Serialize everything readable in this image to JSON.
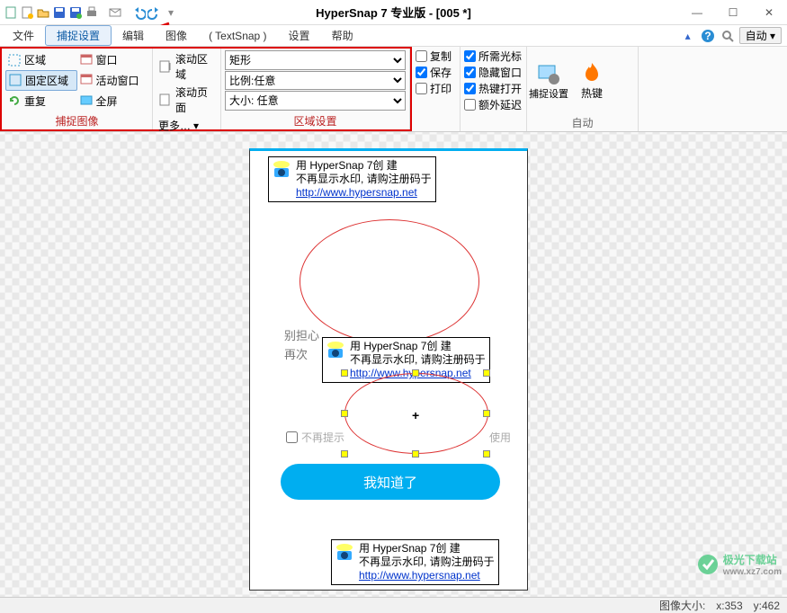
{
  "title": "HyperSnap 7 专业版 - [005 *]",
  "menu": {
    "file": "文件",
    "capture": "捕捉设置",
    "edit": "编辑",
    "image": "图像",
    "textsnap": "( TextSnap )",
    "setup": "设置",
    "help": "帮助",
    "auto": "自动"
  },
  "ribbon": {
    "image_group": "捕捉图像",
    "region_group": "区域设置",
    "auto_group": "自动",
    "items": {
      "region": "区域",
      "window": "窗口",
      "scroll_region": "滚动区域",
      "fixed": "固定区域",
      "active_window": "活动窗口",
      "scroll_page": "滚动页面",
      "repeat": "重复",
      "fullscreen": "全屏",
      "more": "更多…"
    },
    "shape": "矩形",
    "ratio_label": "比例:",
    "ratio_value": "任意",
    "size_label": "大小:",
    "size_value": "任意",
    "save": {
      "copy": "复制",
      "save": "保存",
      "print": "打印"
    },
    "hide": {
      "cursor": "所需光标",
      "hidewin": "隐藏窗口",
      "hotkeyon": "热键打开",
      "extra": "额外延迟"
    },
    "autogrp": {
      "capture_settings": "捕捉设置",
      "hotkey": "热键"
    }
  },
  "doc": {
    "wm_line1": "用 HyperSnap 7创 建",
    "wm_line2": "不再显示水印, 请购注册码于",
    "wm_link": "http://www.hypersnap.net",
    "txt1": "别担心",
    "txt2": "再次",
    "noshow": "不再提示",
    "use": "使用",
    "ok": "我知道了"
  },
  "status": {
    "size_label": "图像大小:",
    "x": "x:353",
    "y": "y:462"
  },
  "branding": {
    "site": "极光下载站",
    "url": "www.xz7.com"
  }
}
